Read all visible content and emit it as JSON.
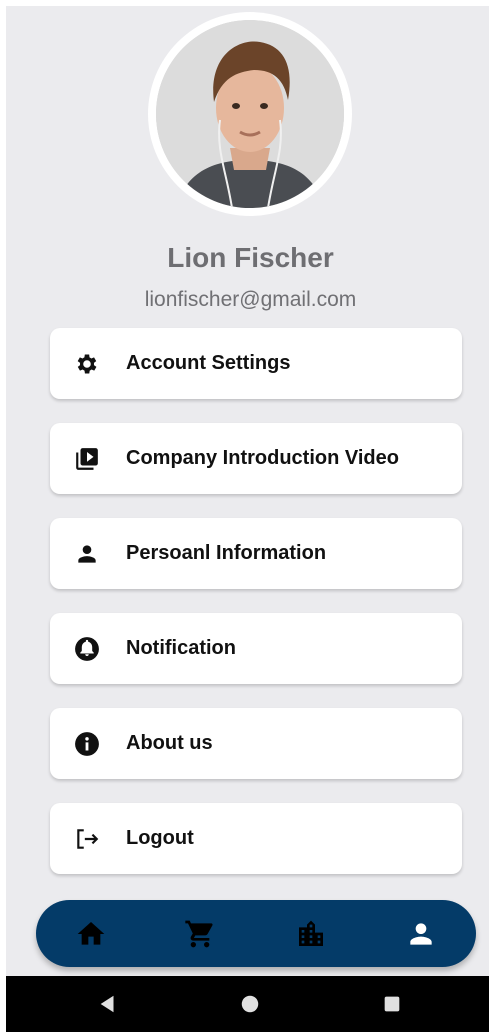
{
  "profile": {
    "name": "Lion Fischer",
    "email": "lionfischer@gmail.com"
  },
  "menu": {
    "items": [
      {
        "label": "Account Settings",
        "icon": "gear-icon"
      },
      {
        "label": "Company Introduction Video",
        "icon": "video-library-icon"
      },
      {
        "label": "Persoanl Information",
        "icon": "person-icon"
      },
      {
        "label": "Notification",
        "icon": "bell-icon"
      },
      {
        "label": "About us",
        "icon": "info-icon"
      },
      {
        "label": "Logout",
        "icon": "logout-icon"
      }
    ]
  },
  "bottom_nav": {
    "items": [
      {
        "icon": "home-icon"
      },
      {
        "icon": "cart-icon"
      },
      {
        "icon": "building-icon"
      },
      {
        "icon": "person-icon",
        "active": true
      }
    ]
  },
  "colors": {
    "nav_background": "#043b68",
    "screen_background": "#ebebee",
    "card_background": "#ffffff"
  }
}
